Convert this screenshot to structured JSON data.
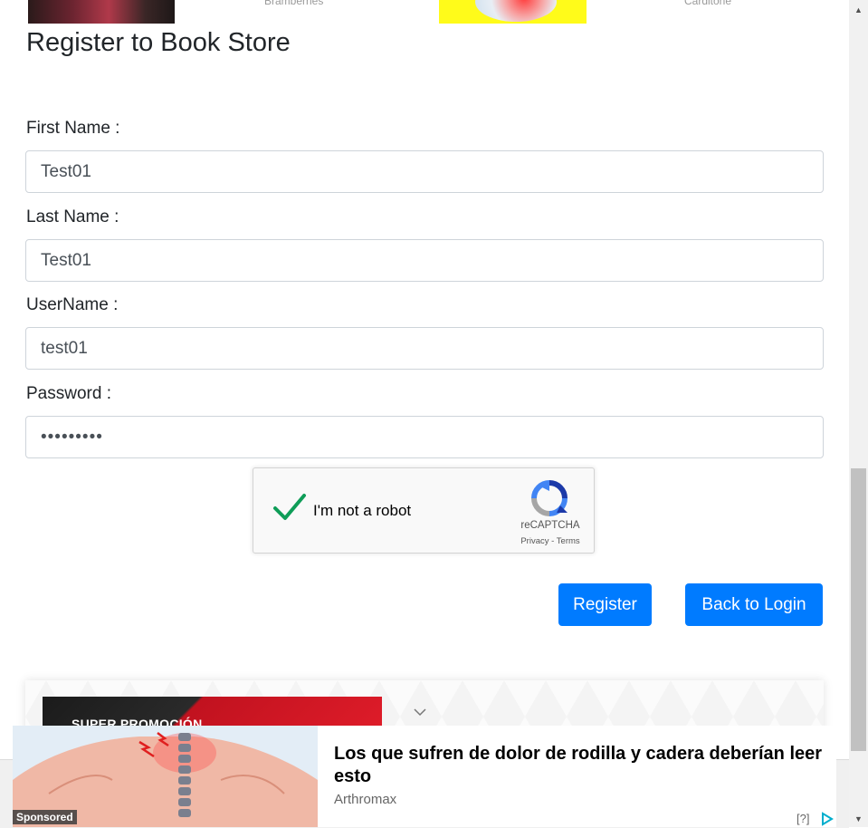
{
  "top_ads": {
    "caption_1": "Bramberries",
    "caption_2": "Carditone"
  },
  "page": {
    "title": "Register to Book Store"
  },
  "form": {
    "first_name": {
      "label": "First Name :",
      "value": "Test01"
    },
    "last_name": {
      "label": "Last Name :",
      "value": "Test01"
    },
    "username": {
      "label": "UserName :",
      "value": "test01"
    },
    "password": {
      "label": "Password :",
      "value": "•••••••••"
    }
  },
  "captcha": {
    "label": "I'm not a robot",
    "brand": "reCAPTCHA",
    "privacy": "Privacy",
    "separator": " - ",
    "terms": "Terms",
    "checked": true
  },
  "buttons": {
    "register": "Register",
    "back_to_login": "Back to Login"
  },
  "ad_block": {
    "banner_text": "SUPER PROMOCIÓN"
  },
  "sponsored": {
    "headline": "Los que sufren de dolor de rodilla y cadera deberían leer esto",
    "source": "Arthromax",
    "tag": "Sponsored",
    "info": "[?]"
  },
  "colors": {
    "primary": "#007bff",
    "captcha_check": "#0f9d58",
    "recaptcha_blue": "#1c3aa9",
    "recaptcha_gray": "#a6a6a6",
    "adchoices": "#00aecd"
  },
  "icons": {
    "captcha_check": "check-icon",
    "captcha_logo": "recaptcha-logo-icon",
    "ad_collapse": "chevron-down-icon",
    "adchoices": "adchoices-icon",
    "scroll_up": "scroll-up-arrow-icon",
    "scroll_down": "scroll-down-arrow-icon"
  }
}
